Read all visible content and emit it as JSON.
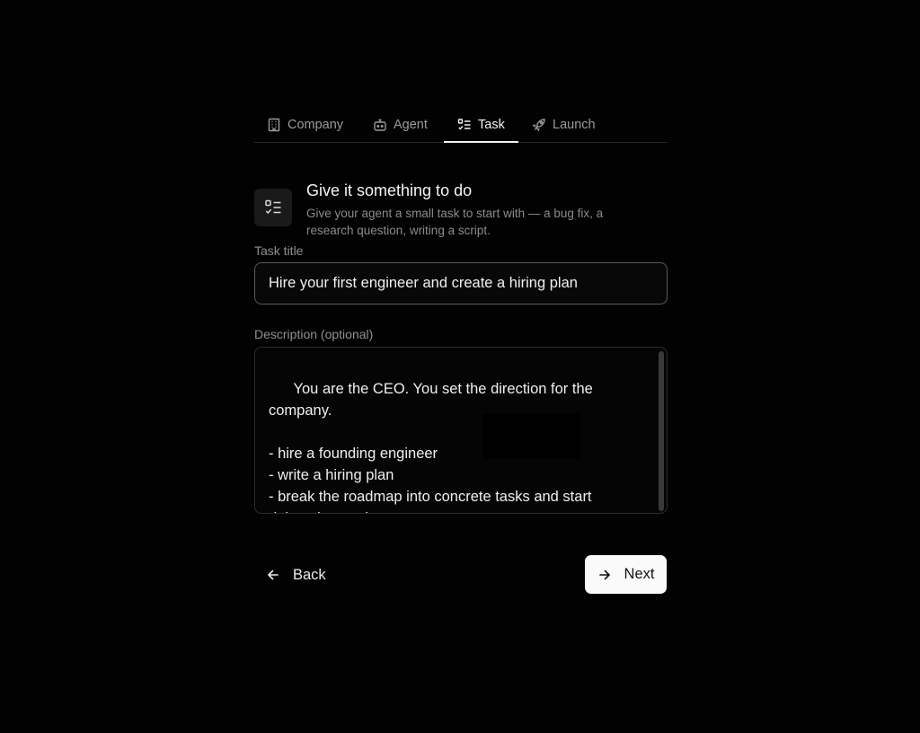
{
  "tabs": [
    {
      "label": "Company",
      "icon": "building-icon",
      "active": false
    },
    {
      "label": "Agent",
      "icon": "bot-icon",
      "active": false
    },
    {
      "label": "Task",
      "icon": "list-check-icon",
      "active": true
    },
    {
      "label": "Launch",
      "icon": "rocket-icon",
      "active": false
    }
  ],
  "header": {
    "icon": "list-check-icon",
    "title": "Give it something to do",
    "description": "Give your agent a small task to start with — a bug fix, a research question, writing a script."
  },
  "task_title": {
    "label": "Task title",
    "value": "Hire your first engineer and create a hiring plan"
  },
  "description": {
    "label": "Description (optional)",
    "value": "You are the CEO. You set the direction for the company.\n\n- hire a founding engineer\n- write a hiring plan\n- break the roadmap into concrete tasks and start delegating work"
  },
  "actions": {
    "back_label": "Back",
    "next_label": "Next"
  },
  "colors": {
    "background": "#020202",
    "primary_button_bg": "#fafafa",
    "primary_button_text": "#111111",
    "active_tab": "#f2f2f2",
    "inactive_tab": "#9a9a9a"
  }
}
